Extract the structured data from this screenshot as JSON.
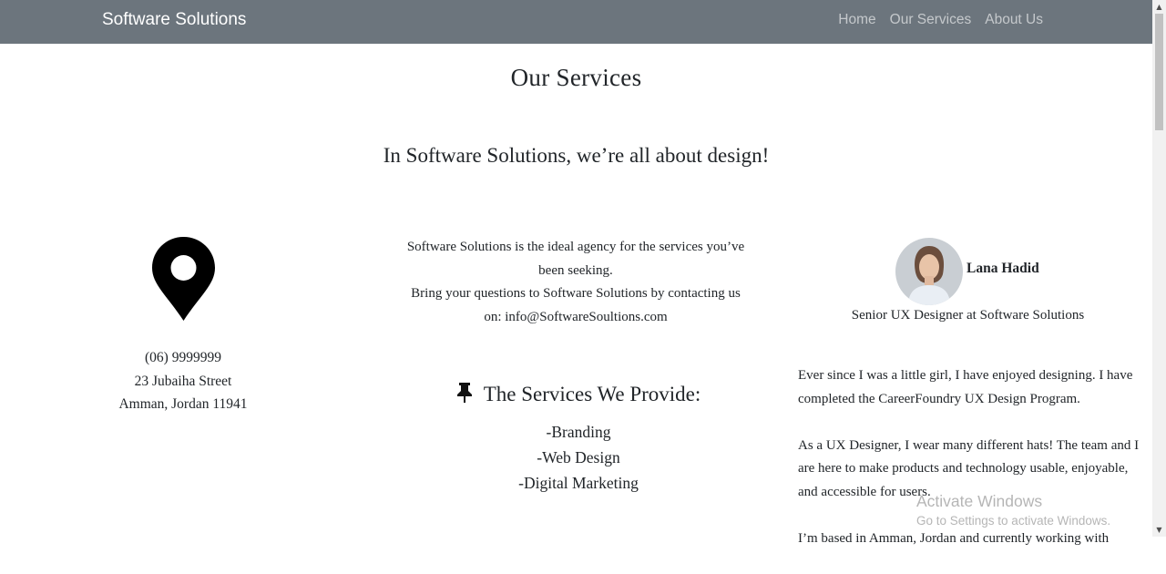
{
  "navbar": {
    "brand": "Software Solutions",
    "links": [
      "Home",
      "Our Services",
      "About Us"
    ]
  },
  "page": {
    "title": "Our Services",
    "tagline": "In Software Solutions, we’re all about design!"
  },
  "contact": {
    "icon": "location-pin-icon",
    "phone": "(06) 9999999",
    "street": "23 Jubaiha Street",
    "city": "Amman, Jordan 11941"
  },
  "intro": {
    "line1": "Software Solutions is the ideal agency for the services you’ve been seeking.",
    "line2": "Bring your questions to Software Solutions by contacting us on: info@SoftwareSoultions.com"
  },
  "services": {
    "icon": "pushpin-icon",
    "heading": "The Services We Provide:",
    "items": [
      "-Branding",
      "-Web Design",
      "-Digital Marketing"
    ]
  },
  "profile": {
    "name": "Lana Hadid",
    "role": "Senior UX Designer at Software Solutions",
    "bio": [
      "Ever since I was a little girl, I have enjoyed designing. I have completed the CareerFoundry UX Design Program.",
      "As a UX Designer, I wear many different hats! The team and I are here to make products and technology usable, enjoyable, and accessible for users.",
      "I’m based in Amman, Jordan and currently working with"
    ]
  },
  "watermark": {
    "title": "Activate Windows",
    "subtitle": "Go to Settings to activate Windows."
  },
  "colors": {
    "navbar_bg": "#6c757d",
    "text": "#212529",
    "page_bg": "#ffffff"
  }
}
